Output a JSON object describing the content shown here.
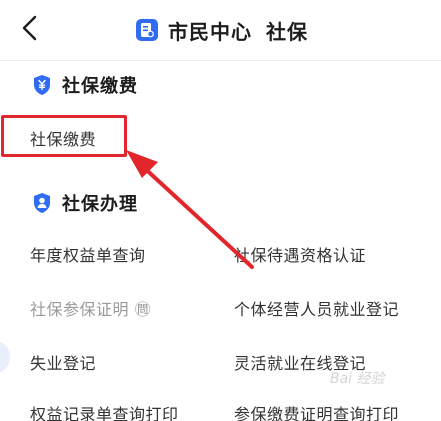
{
  "header": {
    "back_icon": "chevron-left-icon",
    "app_logo_icon": "document-logo-icon",
    "title": "市民中心",
    "subtitle": "社保"
  },
  "section_payment": {
    "icon": "shield-yen-icon",
    "title": "社保缴费",
    "items": [
      {
        "label": "社保缴费"
      }
    ]
  },
  "section_services": {
    "icon": "shield-person-icon",
    "title": "社保办理",
    "items": [
      {
        "label": "年度权益单查询"
      },
      {
        "label": "社保待遇资格认证"
      },
      {
        "label": "社保参保证明 ㉄"
      },
      {
        "label": "个体经营人员就业登记"
      },
      {
        "label": "失业登记"
      },
      {
        "label": "灵活就业在线登记"
      },
      {
        "label": "权益记录单查询打印"
      },
      {
        "label": "参保缴费证明查询打印"
      }
    ]
  },
  "annotation": {
    "highlight_color": "#e3262b"
  },
  "watermark": {
    "text": "Bai 经验"
  },
  "colors": {
    "accent": "#2f6cf3",
    "text": "#333333",
    "disabled_text": "#9a9a9a"
  }
}
